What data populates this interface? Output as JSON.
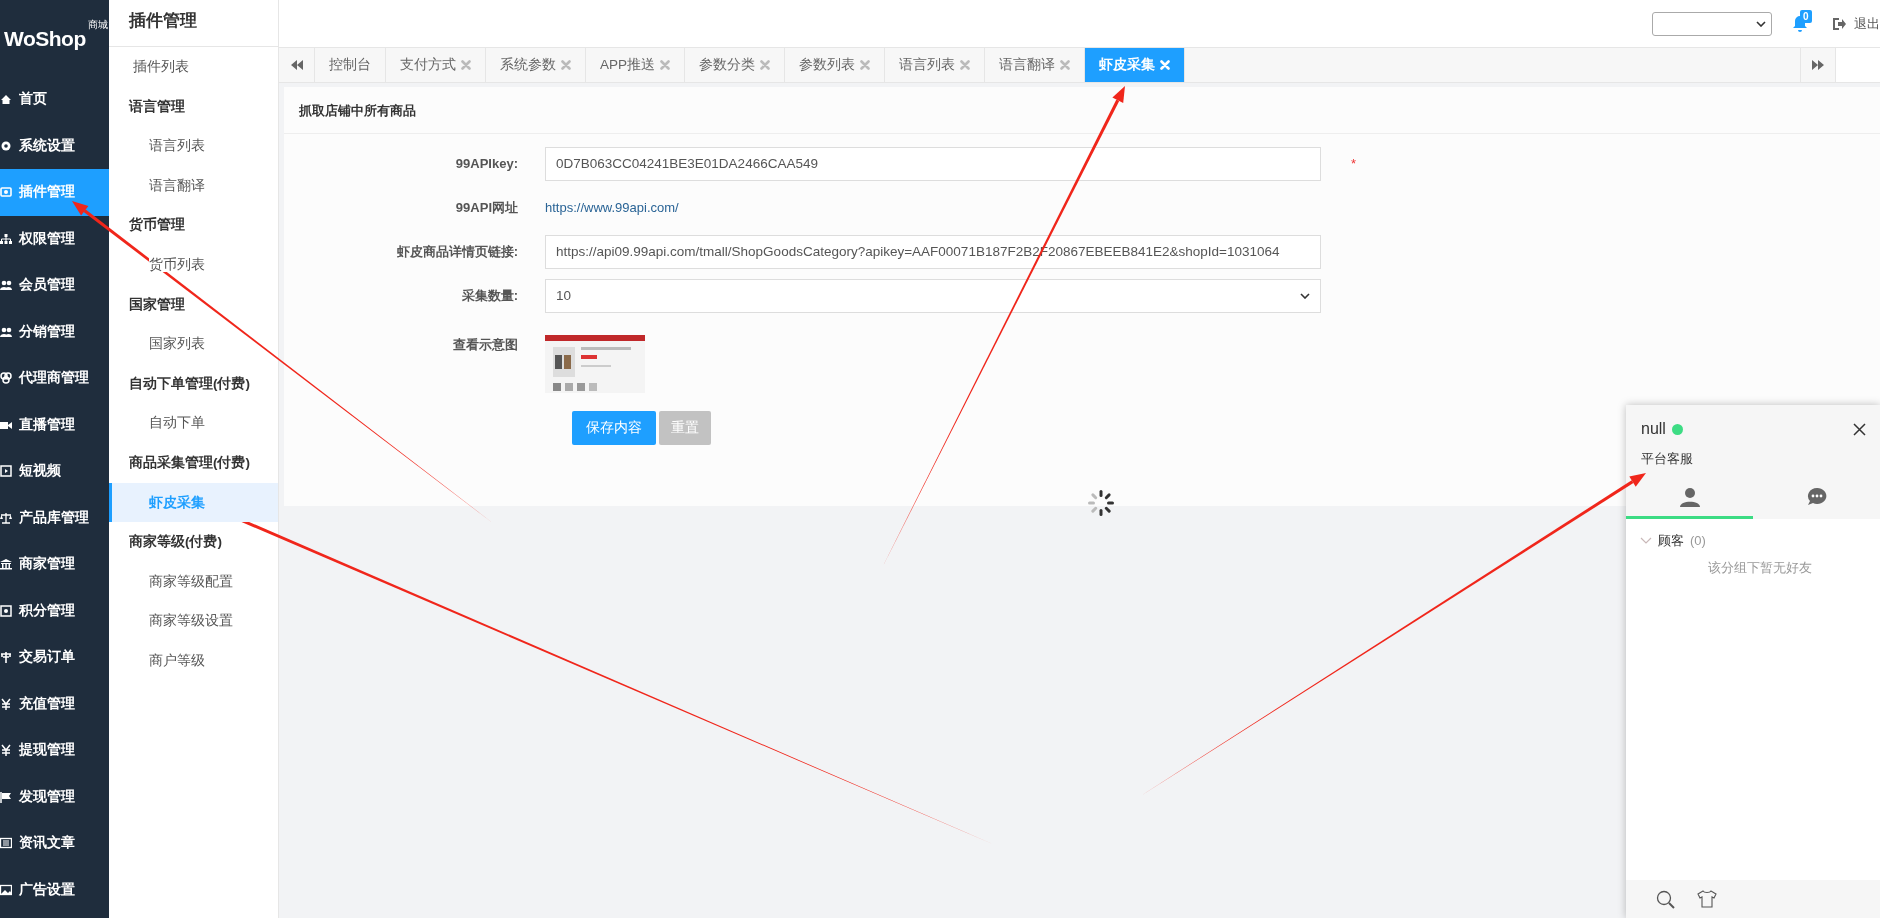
{
  "logo": {
    "brand": "WoShop",
    "tag": "商城"
  },
  "sidebar": {
    "items": [
      {
        "label": "首页",
        "selected": false
      },
      {
        "label": "系统设置",
        "selected": false
      },
      {
        "label": "插件管理",
        "selected": true
      },
      {
        "label": "权限管理",
        "selected": false
      },
      {
        "label": "会员管理",
        "selected": false
      },
      {
        "label": "分销管理",
        "selected": false
      },
      {
        "label": "代理商管理",
        "selected": false
      },
      {
        "label": "直播管理",
        "selected": false
      },
      {
        "label": "短视频",
        "selected": false
      },
      {
        "label": "产品库管理",
        "selected": false
      },
      {
        "label": "商家管理",
        "selected": false
      },
      {
        "label": "积分管理",
        "selected": false
      },
      {
        "label": "交易订单",
        "selected": false
      },
      {
        "label": "充值管理",
        "selected": false
      },
      {
        "label": "提现管理",
        "selected": false
      },
      {
        "label": "发现管理",
        "selected": false
      },
      {
        "label": "资讯文章",
        "selected": false
      },
      {
        "label": "广告设置",
        "selected": false
      }
    ]
  },
  "submenu": {
    "title": "插件管理",
    "items": [
      {
        "kind": "link",
        "label": "插件列表",
        "selected": false
      },
      {
        "kind": "group",
        "label": "语言管理",
        "children": [
          {
            "label": "语言列表",
            "selected": false
          },
          {
            "label": "语言翻译",
            "selected": false
          }
        ]
      },
      {
        "kind": "group",
        "label": "货币管理",
        "children": [
          {
            "label": "货币列表",
            "selected": false
          }
        ]
      },
      {
        "kind": "group",
        "label": "国家管理",
        "children": [
          {
            "label": "国家列表",
            "selected": false
          }
        ]
      },
      {
        "kind": "group",
        "label": "自动下单管理(付费)",
        "children": [
          {
            "label": "自动下单",
            "selected": false
          }
        ]
      },
      {
        "kind": "group",
        "label": "商品采集管理(付费)",
        "children": [
          {
            "label": "虾皮采集",
            "selected": true
          }
        ]
      },
      {
        "kind": "group",
        "label": "商家等级(付费)",
        "children": [
          {
            "label": "商家等级配置",
            "selected": false
          },
          {
            "label": "商家等级设置",
            "selected": false
          },
          {
            "label": "商户等级",
            "selected": false
          }
        ]
      }
    ]
  },
  "topbar": {
    "notification_count": "0",
    "logout": "退出"
  },
  "tabs": [
    {
      "label": "控制台",
      "closable": false,
      "selected": false
    },
    {
      "label": "支付方式",
      "closable": true,
      "selected": false
    },
    {
      "label": "系统参数",
      "closable": true,
      "selected": false
    },
    {
      "label": "APP推送",
      "closable": true,
      "selected": false
    },
    {
      "label": "参数分类",
      "closable": true,
      "selected": false
    },
    {
      "label": "参数列表",
      "closable": true,
      "selected": false
    },
    {
      "label": "语言列表",
      "closable": true,
      "selected": false
    },
    {
      "label": "语言翻译",
      "closable": true,
      "selected": false
    },
    {
      "label": "虾皮采集",
      "closable": true,
      "selected": true
    }
  ],
  "form": {
    "title": "抓取店铺中所有商品",
    "fields": [
      {
        "kind": "input",
        "label": "99APIkey:",
        "value": "0D7B063CC04241BE3E01DA2466CAA549",
        "required_mark": "*"
      },
      {
        "kind": "link",
        "label": "99API网址",
        "value": "https://www.99api.com/"
      },
      {
        "kind": "input",
        "label": "虾皮商品详情页链接:",
        "value": "https://api09.99api.com/tmall/ShopGoodsCategory?apikey=AAF00071B187F2B2F20867EBEEB841E2&shopId=1031064"
      },
      {
        "kind": "select",
        "label": "采集数量:",
        "value": "10"
      },
      {
        "kind": "image",
        "label": "查看示意图"
      }
    ],
    "buttons": [
      {
        "kind": "primary",
        "label": "保存内容"
      },
      {
        "kind": "secondary",
        "label": "重置"
      }
    ]
  },
  "chat": {
    "name": "null",
    "online": true,
    "subtitle": "平台客服",
    "tabs": [
      {
        "kind": "contacts",
        "selected": true
      },
      {
        "kind": "messages",
        "selected": false
      }
    ],
    "groups": [
      {
        "label": "顾客",
        "count": "(0)",
        "expanded": true,
        "empty_text": "该分组下暂无好友"
      }
    ]
  }
}
